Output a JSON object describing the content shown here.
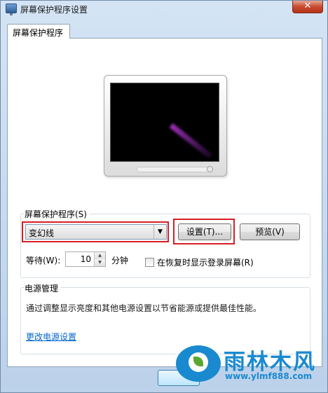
{
  "window": {
    "title": "屏幕保护程序设置",
    "close_glyph": "✕"
  },
  "tab": {
    "label": "屏幕保护程序"
  },
  "screensaver": {
    "group_label": "屏幕保护程序(S)",
    "selected": "变幻线",
    "settings_button": "设置(T)...",
    "preview_button": "预览(V)",
    "wait_label": "等待(W):",
    "wait_value": "10",
    "minutes_label": "分钟",
    "resume_label": "在恢复时显示登录屏幕(R)",
    "resume_checked": false
  },
  "power": {
    "group_label": "电源管理",
    "description": "通过调整显示亮度和其他电源设置以节省能源或提供最佳性能。",
    "link": "更改电源设置"
  },
  "watermark": {
    "brand": "雨林木风",
    "url": "www.ylmf888.com"
  },
  "colors": {
    "highlight_box": "#d61f26",
    "link": "#0066cc",
    "watermark": "#1a8ad0"
  }
}
